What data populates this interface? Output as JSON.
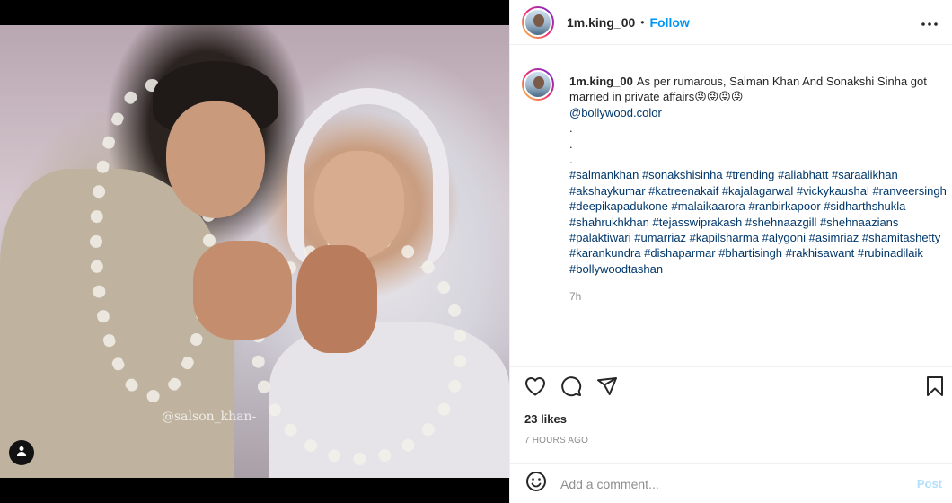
{
  "post": {
    "watermark": "@salson_khan-"
  },
  "header": {
    "username": "1m.king_00",
    "separator": "•",
    "follow_label": "Follow",
    "more_icon": "more-horizontal-icon"
  },
  "caption": {
    "username": "1m.king_00",
    "text": "As per rumarous, Salman Khan And Sonakshi Sinha got married in private affairs😜😜😜😜",
    "mention": "@bollywood.color",
    "dots": [
      ".",
      ".",
      "."
    ],
    "hashtags": "#salmankhan #sonakshisinha #trending #aliabhatt #saraalikhan #akshaykumar #katreenakaif #kajalagarwal #vickykaushal #ranveersingh #deepikapadukone #malaikaarora #ranbirkapoor #sidharthshukla #shahrukhkhan #tejasswiprakash #shehnaazgill #shehnaazians #palaktiwari #umarriaz #kapilsharma #alygoni #asimriaz #shamitashetty #karankundra #dishaparmar #bhartisingh #rakhisawant #rubinadilaik #bollywoodtashan",
    "time": "7h"
  },
  "actions": {
    "like_icon": "heart-icon",
    "comment_icon": "comment-icon",
    "share_icon": "share-icon",
    "save_icon": "bookmark-icon"
  },
  "stats": {
    "likes": "23 likes",
    "posted_ago": "7 HOURS AGO"
  },
  "comment": {
    "placeholder": "Add a comment...",
    "post_label": "Post"
  }
}
